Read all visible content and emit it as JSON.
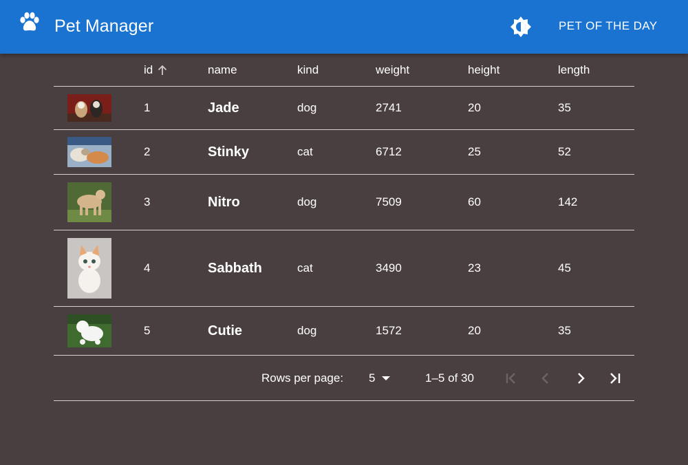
{
  "app": {
    "title": "Pet Manager",
    "potd_label": "PET OF THE DAY",
    "accent": "#1a73d1",
    "background": "#4a3f40"
  },
  "table": {
    "headers": {
      "id": "id",
      "name": "name",
      "kind": "kind",
      "weight": "weight",
      "height": "height",
      "length": "length"
    },
    "sort": {
      "column": "id",
      "direction": "ascending",
      "icon": "arrow-up-icon"
    },
    "rows": [
      {
        "id": "1",
        "name": "Jade",
        "kind": "dog",
        "weight": "2741",
        "height": "20",
        "length": "35",
        "photo": "two-dogs-photo"
      },
      {
        "id": "2",
        "name": "Stinky",
        "kind": "cat",
        "weight": "6712",
        "height": "25",
        "length": "52",
        "photo": "cats-photo"
      },
      {
        "id": "3",
        "name": "Nitro",
        "kind": "dog",
        "weight": "7509",
        "height": "60",
        "length": "142",
        "photo": "tan-dog-photo"
      },
      {
        "id": "4",
        "name": "Sabbath",
        "kind": "cat",
        "weight": "3490",
        "height": "23",
        "length": "45",
        "photo": "white-kitten-photo"
      },
      {
        "id": "5",
        "name": "Cutie",
        "kind": "dog",
        "weight": "1572",
        "height": "20",
        "length": "35",
        "photo": "white-poodle-photo"
      }
    ]
  },
  "pagination": {
    "rows_per_page_label": "Rows per page:",
    "rows_per_page_value": "5",
    "range_text": "1–5 of 30"
  }
}
